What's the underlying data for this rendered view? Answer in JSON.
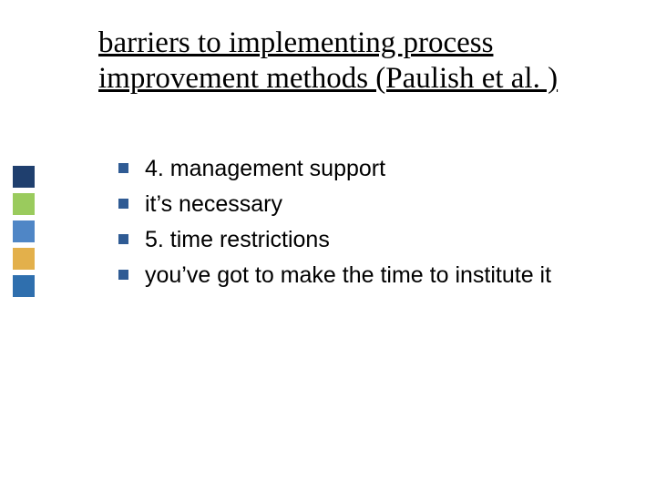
{
  "title": "barriers to implementing process improvement methods (Paulish et al. )",
  "bullets": [
    "4.  management support",
    "it’s necessary",
    "5.  time restrictions",
    "you’ve got to make the time to institute it"
  ],
  "sidebar_colors": [
    "#1f3f6e",
    "#9acb5d",
    "#4f86c6",
    "#e3b04b",
    "#2f6fae"
  ],
  "bullet_color": "#2f5b94"
}
